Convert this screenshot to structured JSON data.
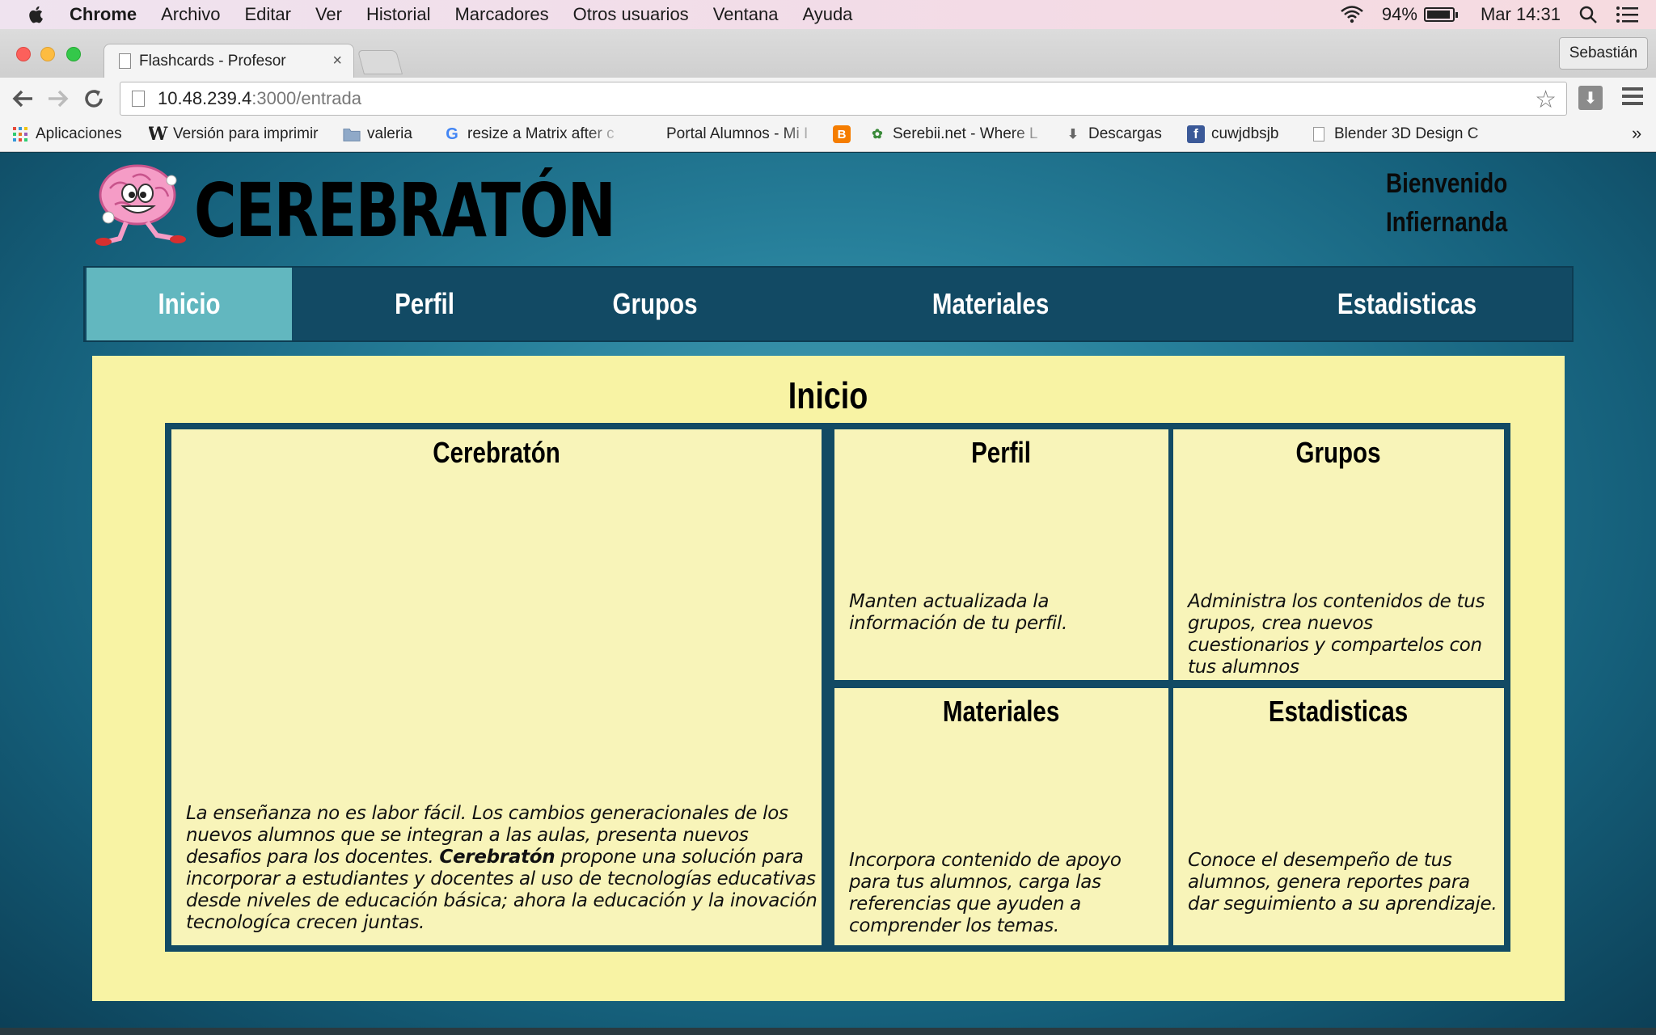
{
  "menubar": {
    "app": "Chrome",
    "items": [
      "Archivo",
      "Editar",
      "Ver",
      "Historial",
      "Marcadores",
      "Otros usuarios",
      "Ventana",
      "Ayuda"
    ],
    "battery": "94%",
    "battery_level": 0.94,
    "clock": "Mar 14:31"
  },
  "browser": {
    "tab_title": "Flashcards - Profesor",
    "tab_close": "×",
    "profile": "Sebastián",
    "url_host": "10.48.239.4",
    "url_path": ":3000/entrada",
    "bookmarks": [
      {
        "label": "Aplicaciones",
        "icon": "apps-grid-icon"
      },
      {
        "label": "Versión para imprimir",
        "icon": "wikipedia-icon"
      },
      {
        "label": "valeria",
        "icon": "folder-icon"
      },
      {
        "label": "resize a Matrix after c",
        "icon": "google-icon"
      },
      {
        "label": "Portal Alumnos - Mi I",
        "icon": "blank-icon"
      },
      {
        "label": "",
        "icon": "blogger-icon"
      },
      {
        "label": "Serebii.net - Where L",
        "icon": "serebii-icon"
      },
      {
        "label": "Descargas",
        "icon": "download-arrow-icon"
      },
      {
        "label": "cuwjdbsjb",
        "icon": "facebook-icon"
      },
      {
        "label": "Blender 3D Design C",
        "icon": "page-icon"
      }
    ],
    "overflow": "»"
  },
  "site": {
    "brand": "CEREBRATÓN",
    "welcome_line1": "Bienvenido",
    "welcome_line2": "Infiernanda",
    "nav": [
      "Inicio",
      "Perfil",
      "Grupos",
      "Materiales",
      "Estadisticas"
    ],
    "active_nav": "Inicio",
    "page_title": "Inicio",
    "cards": {
      "main": {
        "title": "Cerebratón",
        "text_before": "La enseñanza no es labor fácil. Los cambios generacionales de los nuevos alumnos que se integran a las aulas, presenta nuevos desafios para los docentes. ",
        "text_bold": "Cerebratón",
        "text_after": " propone una solución para incorporar a estudiantes y docentes al uso de tecnologías educativas desde niveles de educación básica; ahora la educación y la inovación tecnologíca crecen juntas."
      },
      "perfil": {
        "title": "Perfil",
        "text": "Manten actualizada la información de tu perfil."
      },
      "grupos": {
        "title": "Grupos",
        "text": "Administra los contenidos de tus grupos, crea nuevos cuestionarios y compartelos con tus alumnos"
      },
      "materiales": {
        "title": "Materiales",
        "text": "Incorpora contenido de apoyo para tus alumnos, carga las referencias que ayuden a comprender los temas."
      },
      "estadisticas": {
        "title": "Estadisticas",
        "text": "Conoce el desempeño de tus alumnos, genera reportes para dar seguimiento a su aprendizaje."
      }
    }
  },
  "colors": {
    "nav_bg": "#124a64",
    "nav_active": "#62b7bf",
    "panel_bg": "#f8f3a4",
    "card_bg": "#f8f4b9"
  }
}
